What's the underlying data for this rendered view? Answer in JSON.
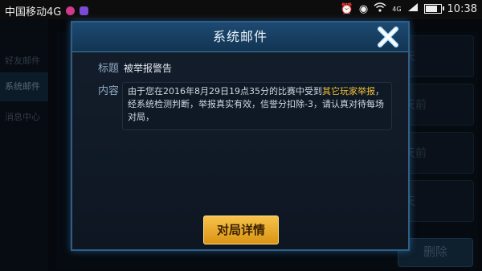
{
  "status_bar": {
    "carrier": "中国移动4G",
    "network": "4G",
    "time": "10:38",
    "battery_level": 0.9
  },
  "sidebar": {
    "items": [
      {
        "label": "好友邮件",
        "active": false
      },
      {
        "label": "系统邮件",
        "active": true
      },
      {
        "label": "消息中心",
        "active": false
      }
    ]
  },
  "mail_list": {
    "rows": [
      {
        "time": "天"
      },
      {
        "time": "天前"
      },
      {
        "time": "天前"
      },
      {
        "time": "天"
      }
    ],
    "delete_label": "删除"
  },
  "dialog": {
    "title": "系统邮件",
    "subject_label": "标题",
    "subject": "被举报警告",
    "content_label": "内容",
    "content_before": "由于您在2016年8月29日19点35分的比赛中受到",
    "content_highlight": "其它玩家举报",
    "content_after": "，经系统检测判断，举报真实有效，信誉分扣除-3，请认真对待每场对局，",
    "detail_button": "对局详情"
  },
  "colors": {
    "accent": "#2f5e86",
    "highlight": "#f2c037",
    "button_gold": "#e8a82a"
  }
}
